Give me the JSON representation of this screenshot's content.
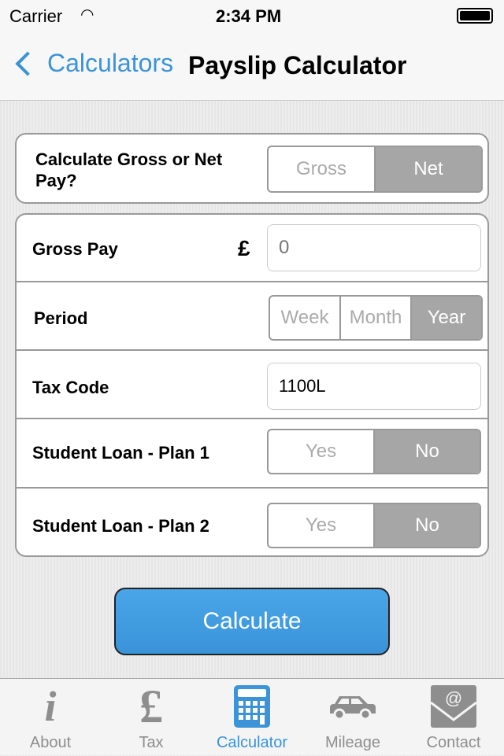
{
  "status": {
    "carrier": "Carrier",
    "time": "2:34 PM"
  },
  "nav": {
    "back_label": "Calculators",
    "title": "Payslip Calculator"
  },
  "mode": {
    "label": "Calculate Gross or Net Pay?",
    "options": [
      "Gross",
      "Net"
    ],
    "selected": "Net"
  },
  "form": {
    "gross_pay": {
      "label": "Gross Pay",
      "currency": "£",
      "placeholder": "0",
      "value": ""
    },
    "period": {
      "label": "Period",
      "options": [
        "Week",
        "Month",
        "Year"
      ],
      "selected": "Year"
    },
    "tax_code": {
      "label": "Tax Code",
      "value": "1100L"
    },
    "plan1": {
      "label": "Student Loan - Plan 1",
      "options": [
        "Yes",
        "No"
      ],
      "selected": "No"
    },
    "plan2": {
      "label": "Student Loan - Plan 2",
      "options": [
        "Yes",
        "No"
      ],
      "selected": "No"
    }
  },
  "calculate_label": "Calculate",
  "tabs": [
    {
      "label": "About",
      "icon": "info-icon"
    },
    {
      "label": "Tax",
      "icon": "pound-icon"
    },
    {
      "label": "Calculator",
      "icon": "calculator-icon",
      "active": true
    },
    {
      "label": "Mileage",
      "icon": "car-icon"
    },
    {
      "label": "Contact",
      "icon": "email-icon"
    }
  ],
  "colors": {
    "accent": "#3b93d8",
    "selected_segment": "#a6a6a6",
    "button": "#3d9be0"
  }
}
